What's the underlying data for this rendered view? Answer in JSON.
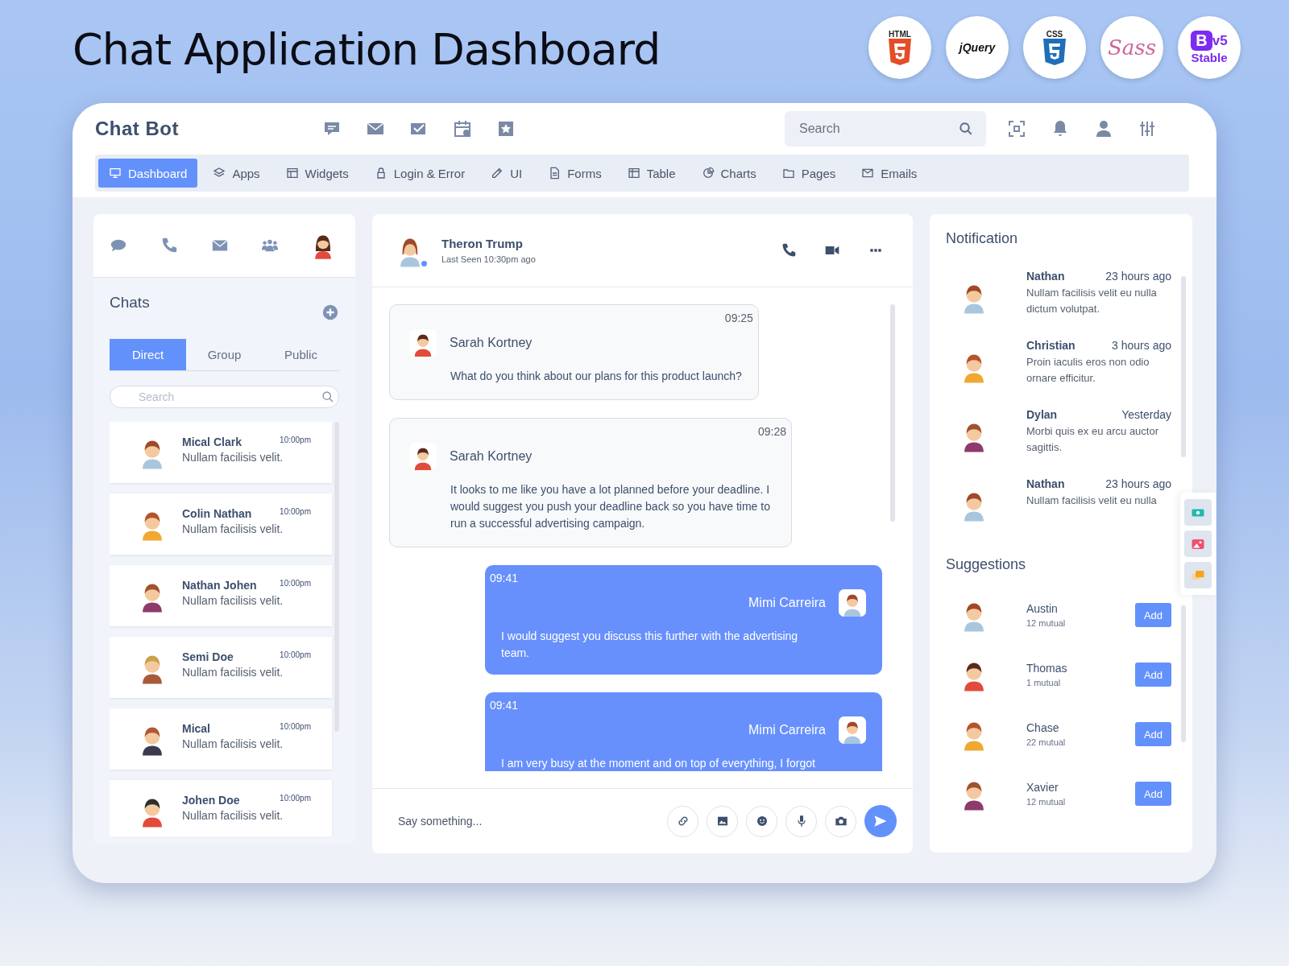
{
  "page_title": "Chat Application Dashboard",
  "badges": [
    {
      "kind": "html",
      "label": "HTML"
    },
    {
      "kind": "jquery",
      "label": "jQuery"
    },
    {
      "kind": "css",
      "label": "CSS"
    },
    {
      "kind": "sass",
      "label": "Sass"
    },
    {
      "kind": "bootstrap",
      "label": "B",
      "version": "v5",
      "note": "Stable"
    }
  ],
  "app": {
    "brand": "Chat Bot",
    "search": {
      "placeholder": "Search"
    }
  },
  "nav": [
    {
      "label": "Dashboard",
      "selected": true
    },
    {
      "label": "Apps",
      "selected": false
    },
    {
      "label": "Widgets",
      "selected": false
    },
    {
      "label": "Login & Error",
      "selected": false
    },
    {
      "label": "UI",
      "selected": false
    },
    {
      "label": "Forms",
      "selected": false
    },
    {
      "label": "Table",
      "selected": false
    },
    {
      "label": "Charts",
      "selected": false
    },
    {
      "label": "Pages",
      "selected": false
    },
    {
      "label": "Emails",
      "selected": false
    }
  ],
  "chats": {
    "title": "Chats",
    "tabs": [
      {
        "label": "Direct",
        "selected": true
      },
      {
        "label": "Group",
        "selected": false
      },
      {
        "label": "Public",
        "selected": false
      }
    ],
    "search": {
      "placeholder": "Search"
    },
    "items": [
      {
        "name": "Mical Clark",
        "time": "10:00pm",
        "message": "Nullam facilisis velit."
      },
      {
        "name": "Colin Nathan",
        "time": "10:00pm",
        "message": "Nullam facilisis velit."
      },
      {
        "name": "Nathan Johen",
        "time": "10:00pm",
        "message": "Nullam facilisis velit."
      },
      {
        "name": "Semi Doe",
        "time": "10:00pm",
        "message": "Nullam facilisis velit."
      },
      {
        "name": "Mical",
        "time": "10:00pm",
        "message": "Nullam facilisis velit."
      },
      {
        "name": "Johen Doe",
        "time": "10:00pm",
        "message": "Nullam facilisis velit."
      }
    ]
  },
  "conversation": {
    "contact": {
      "name": "Theron Trump",
      "status": "Last Seen 10:30pm ago",
      "online": true
    },
    "messages": [
      {
        "kind": "incoming",
        "time": "09:25",
        "sender": "Sarah Kortney",
        "text": "What do you think about our plans for this product launch?"
      },
      {
        "kind": "incoming",
        "time": "09:28",
        "sender": "Sarah Kortney",
        "text": "It looks to me like you have a lot planned before your deadline. I would suggest you push your deadline back so you have time to run a successful advertising campaign."
      },
      {
        "kind": "outgoing",
        "time": "09:41",
        "sender": "Mimi Carreira",
        "text": "I would suggest you discuss this further with the advertising team."
      },
      {
        "kind": "outgoing",
        "time": "09:41",
        "sender": "Mimi Carreira",
        "text": "I am very busy at the moment and on top of everything, I forgot"
      }
    ],
    "composer": {
      "placeholder": "Say something..."
    }
  },
  "notifications": {
    "title": "Notification",
    "items": [
      {
        "name": "Nathan",
        "time": "23 hours ago",
        "text": "Nullam facilisis velit eu nulla dictum volutpat."
      },
      {
        "name": "Christian",
        "time": "3 hours ago",
        "text": "Proin iaculis eros non odio ornare efficitur."
      },
      {
        "name": "Dylan",
        "time": "Yesterday",
        "text": "Morbi quis ex eu arcu auctor sagittis."
      },
      {
        "name": "Nathan",
        "time": "23 hours ago",
        "text": "Nullam facilisis velit eu nulla"
      }
    ]
  },
  "suggestions": {
    "title": "Suggestions",
    "items": [
      {
        "name": "Austin",
        "mutual": "12 mutual",
        "action": "Add"
      },
      {
        "name": "Thomas",
        "mutual": "1 mutual",
        "action": "Add"
      },
      {
        "name": "Chase",
        "mutual": "22 mutual",
        "action": "Add"
      },
      {
        "name": "Xavier",
        "mutual": "12 mutual",
        "action": "Add"
      }
    ]
  }
}
